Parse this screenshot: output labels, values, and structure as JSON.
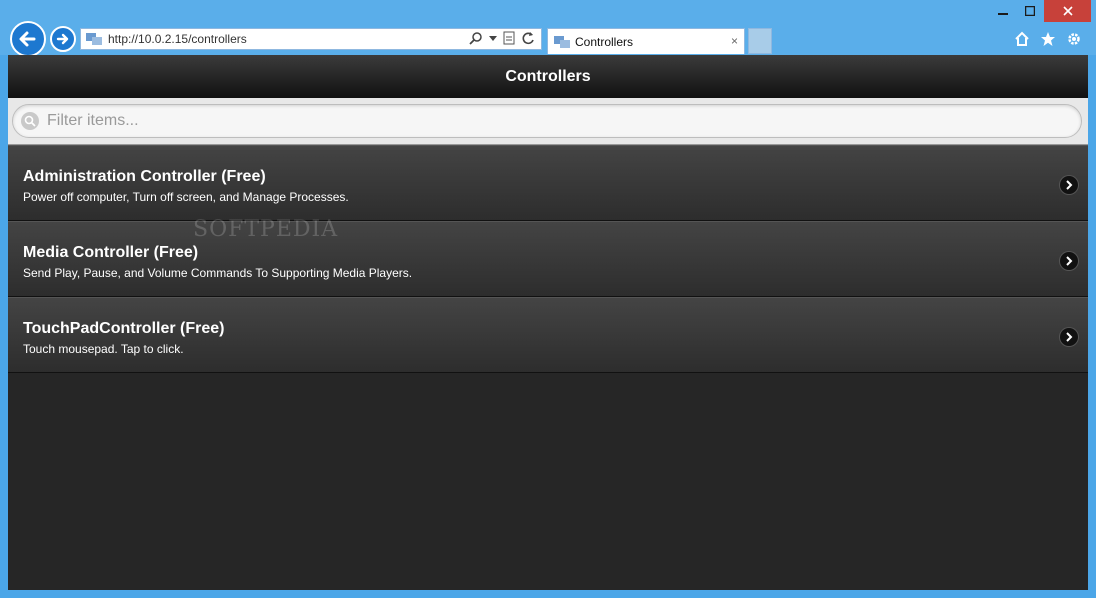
{
  "window": {
    "minimize_icon": "minimize-icon",
    "maximize_icon": "maximize-icon",
    "close_icon": "close-icon"
  },
  "browser": {
    "address_url": "http://10.0.2.15/controllers",
    "tab_title": "Controllers",
    "tab_close": "×"
  },
  "page": {
    "title": "Controllers",
    "filter_placeholder": "Filter items...",
    "watermark": "SOFTPEDIA"
  },
  "controllers": [
    {
      "title": "Administration Controller (Free)",
      "description": "Power off computer, Turn off screen, and Manage Processes."
    },
    {
      "title": "Media Controller (Free)",
      "description": "Send Play, Pause, and Volume Commands To Supporting Media Players."
    },
    {
      "title": "TouchPadController (Free)",
      "description": "Touch mousepad. Tap to click."
    }
  ],
  "colors": {
    "window_frame": "#4ba6e8",
    "close_button": "#c7413a",
    "content_bg": "#262626"
  }
}
